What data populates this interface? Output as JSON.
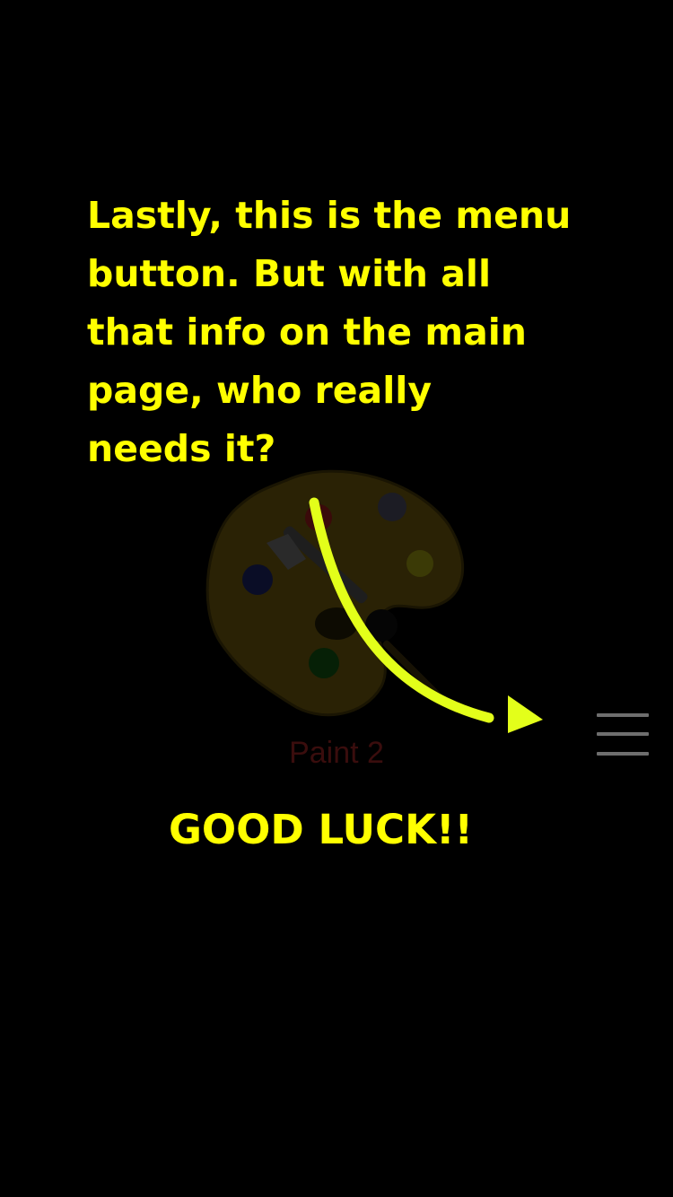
{
  "app_tile": {
    "label": "Paint 2",
    "icon": "paint-palette-icon"
  },
  "tutorial": {
    "message": "Lastly, this is the menu\nbutton.   But with all\nthat info on the main\npage, who really\nneeds it?",
    "closing": "GOOD LUCK!!",
    "text_color": "#ffff00",
    "arrow_color": "#e3ff1a"
  },
  "menu_button": {
    "icon": "hamburger-menu-icon",
    "color": "#6e6e6e"
  }
}
